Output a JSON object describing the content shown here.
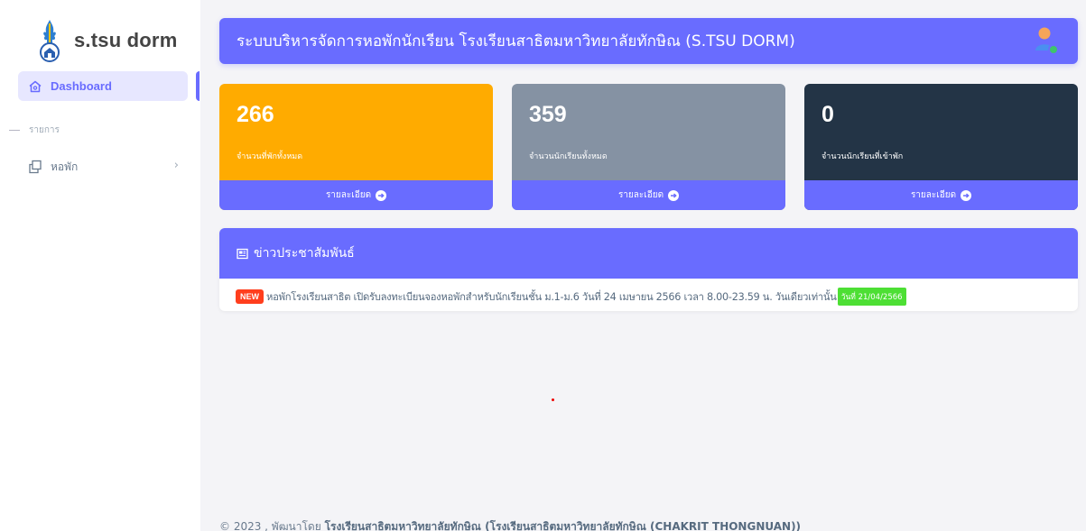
{
  "brand": {
    "name": "s.tsu dorm"
  },
  "sidebar": {
    "active_item": {
      "label": "Dashboard"
    },
    "section_label": "รายการ",
    "items": [
      {
        "label": "หอพัก"
      }
    ]
  },
  "header": {
    "title": "ระบบบริหารจัดการหอพักนักเรียน โรงเรียนสาธิตมหาวิทยาลัยทักษิณ (S.TSU DORM)"
  },
  "cards": [
    {
      "value": "266",
      "label": "จำนวนที่พักทั้งหมด",
      "link": "รายละเอียด",
      "color": "#ffab00"
    },
    {
      "value": "359",
      "label": "จำนวนนักเรียนทั้งหมด",
      "link": "รายละเอียด",
      "color": "#8592a3"
    },
    {
      "value": "0",
      "label": "จำนวนนักเรียนที่เข้าพัก",
      "link": "รายละเอียด",
      "color": "#233446"
    }
  ],
  "news": {
    "title": "ข่าวประชาสัมพันธ์",
    "items": [
      {
        "badge": "NEW",
        "text": "หอพักโรงเรียนสาธิต เปิดรับลงทะเบียนจองหอพักสำหรับนักเรียนชั้น ม.1-ม.6 วันที่ 24 เมษายน 2566 เวลา 8.00-23.59 น. วันเดียวเท่านั้น",
        "date": "วันที่ 21/04/2566"
      }
    ]
  },
  "footer": {
    "prefix": "© 2023 , พัฒนาโดย",
    "org": "โรงเรียนสาธิตมหาวิทยาลัยทักษิณ (โรงเรียนสาธิตมหาวิทยาลัยทักษิณ (CHAKRIT THONGNUAN))"
  },
  "colors": {
    "accent": "#696cff",
    "accent_light": "#e7e7ff",
    "new_badge": "#ff3e1d",
    "date_badge": "#4ddf34"
  }
}
